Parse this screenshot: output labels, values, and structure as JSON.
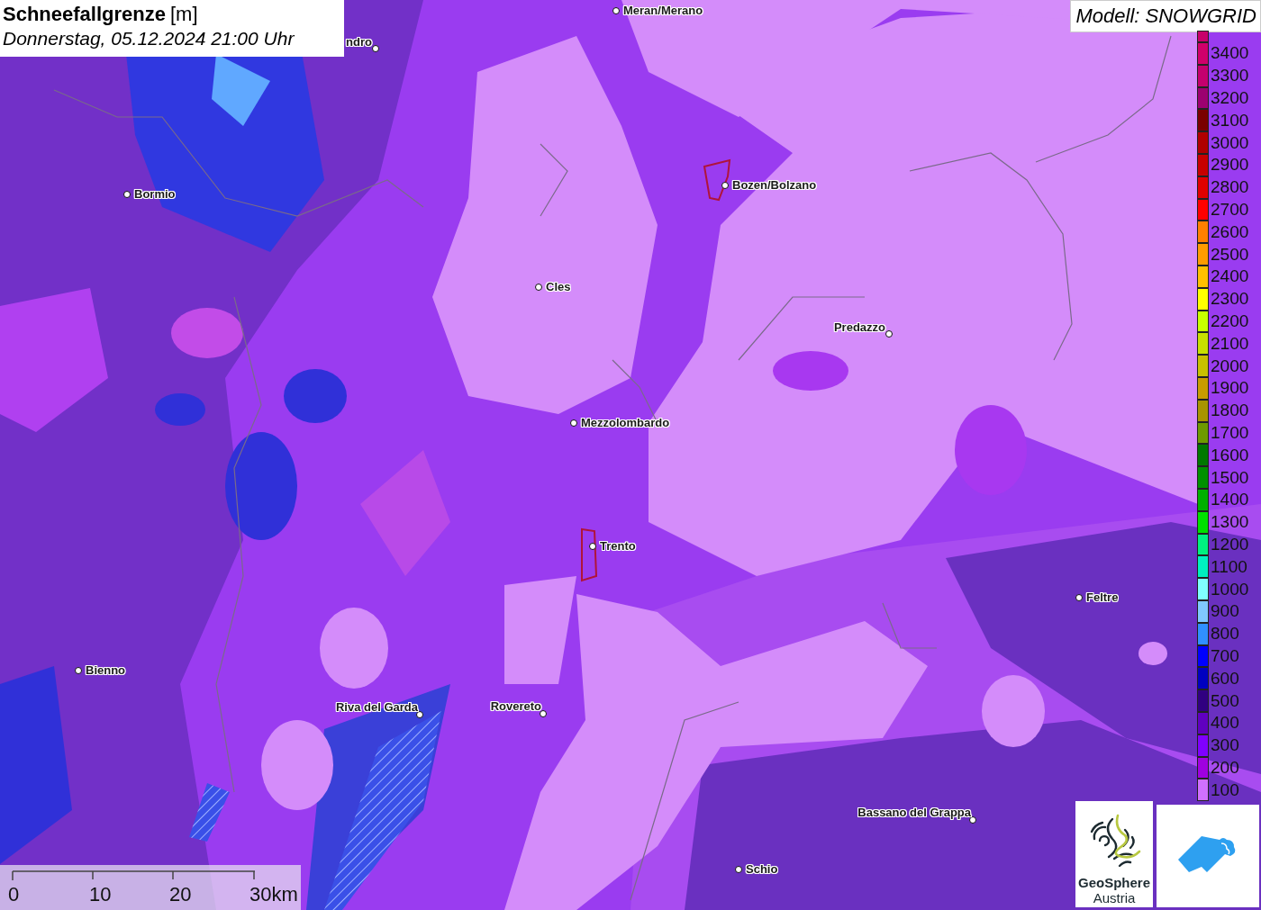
{
  "header": {
    "title": "Schneefallgrenze",
    "unit": "[m]",
    "subtitle": "Donnerstag, 05.12.2024 21:00 Uhr"
  },
  "model_label": "Modell: SNOWGRID",
  "legend": [
    {
      "label": "3400",
      "color": "#d0006a"
    },
    {
      "label": "3300",
      "color": "#c4006e"
    },
    {
      "label": "3200",
      "color": "#9c0070"
    },
    {
      "label": "3100",
      "color": "#7a0000"
    },
    {
      "label": "3000",
      "color": "#b00000"
    },
    {
      "label": "2900",
      "color": "#c80000"
    },
    {
      "label": "2800",
      "color": "#e00000"
    },
    {
      "label": "2700",
      "color": "#ff0000"
    },
    {
      "label": "2600",
      "color": "#ff8000"
    },
    {
      "label": "2500",
      "color": "#ff9c00"
    },
    {
      "label": "2400",
      "color": "#ffc000"
    },
    {
      "label": "2300",
      "color": "#ffff00"
    },
    {
      "label": "2200",
      "color": "#c8ff00"
    },
    {
      "label": "2100",
      "color": "#c8e000"
    },
    {
      "label": "2000",
      "color": "#c8c000"
    },
    {
      "label": "1900",
      "color": "#c89c00"
    },
    {
      "label": "1800",
      "color": "#a89400"
    },
    {
      "label": "1700",
      "color": "#6e9a00"
    },
    {
      "label": "1600",
      "color": "#007800"
    },
    {
      "label": "1500",
      "color": "#009000"
    },
    {
      "label": "1400",
      "color": "#00b000"
    },
    {
      "label": "1300",
      "color": "#00e000"
    },
    {
      "label": "1200",
      "color": "#00f080"
    },
    {
      "label": "1100",
      "color": "#00f0c0"
    },
    {
      "label": "1000",
      "color": "#80ffff"
    },
    {
      "label": "900",
      "color": "#80c8ff"
    },
    {
      "label": "800",
      "color": "#3090ff"
    },
    {
      "label": "700",
      "color": "#0000ff"
    },
    {
      "label": "600",
      "color": "#0000c0"
    },
    {
      "label": "500",
      "color": "#300080"
    },
    {
      "label": "400",
      "color": "#6000c0"
    },
    {
      "label": "300",
      "color": "#8000ff"
    },
    {
      "label": "200",
      "color": "#a000e0"
    },
    {
      "label": "100",
      "color": "#d070ff"
    }
  ],
  "places": [
    {
      "name": "Meran/Merano"
    },
    {
      "name": "ndro"
    },
    {
      "name": "Bormio"
    },
    {
      "name": "Bozen/Bolzano"
    },
    {
      "name": "Cles"
    },
    {
      "name": "Predazzo"
    },
    {
      "name": "Mezzolombardo"
    },
    {
      "name": "Trento"
    },
    {
      "name": "Feltre"
    },
    {
      "name": "Bienno"
    },
    {
      "name": "Riva del Garda"
    },
    {
      "name": "Rovereto"
    },
    {
      "name": "Bassano del Grappa"
    },
    {
      "name": "Schio"
    }
  ],
  "scale_bar": {
    "labels": [
      "0",
      "10",
      "20",
      "30km"
    ]
  },
  "logo": {
    "line_1": "GeoSphere",
    "line_2": "Austria"
  }
}
